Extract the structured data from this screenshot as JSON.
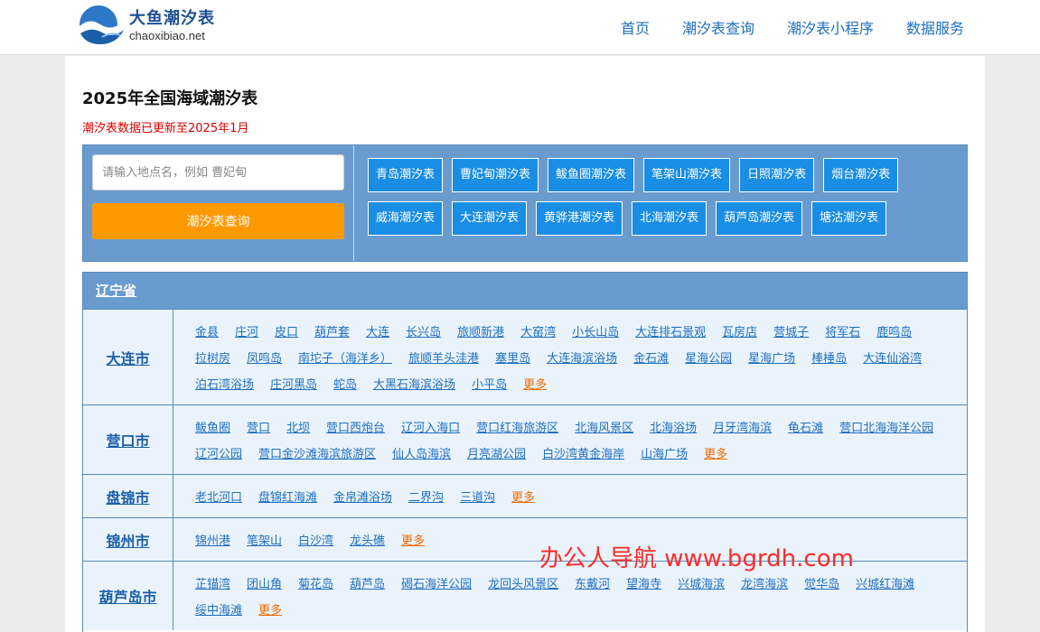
{
  "header": {
    "logo_cn": "大鱼潮汐表",
    "logo_en": "chaoxibiao.net",
    "nav": [
      "首页",
      "潮汐表查询",
      "潮汐表小程序",
      "数据服务"
    ]
  },
  "page": {
    "title": "2025年全国海域潮汐表",
    "update_note": "潮汐表数据已更新至2025年1月"
  },
  "search": {
    "placeholder": "请输入地点名，例如 曹妃甸",
    "button_label": "潮汐表查询",
    "quick_links": [
      "青岛潮汐表",
      "曹妃甸潮汐表",
      "鲅鱼圈潮汐表",
      "笔架山潮汐表",
      "日照潮汐表",
      "烟台潮汐表",
      "威海潮汐表",
      "大连潮汐表",
      "黄骅港潮汐表",
      "北海潮汐表",
      "葫芦岛潮汐表",
      "塘沽潮汐表"
    ]
  },
  "province": {
    "name": "辽宁省",
    "more_label": "更多",
    "cities": [
      {
        "name": "大连市",
        "places": [
          "金县",
          "庄河",
          "皮口",
          "葫芦套",
          "大连",
          "长兴岛",
          "旅顺新港",
          "大窑湾",
          "小长山岛",
          "大连排石景观",
          "瓦房店",
          "营城子",
          "将军石",
          "鹿鸣岛",
          "拉树房",
          "凤鸣岛",
          "南坨子（海洋乡）",
          "旅顺羊头洼港",
          "塞里岛",
          "大连海滨浴场",
          "金石滩",
          "星海公园",
          "星海广场",
          "棒棰岛",
          "大连仙浴湾",
          "泊石湾浴场",
          "庄河黑岛",
          "蛇岛",
          "大黑石海滨浴场",
          "小平岛"
        ]
      },
      {
        "name": "营口市",
        "places": [
          "鲅鱼圈",
          "营口",
          "北坝",
          "营口西炮台",
          "辽河入海口",
          "营口红海旅游区",
          "北海风景区",
          "北海浴场",
          "月牙湾海滨",
          "龟石滩",
          "营口北海海洋公园",
          "辽河公园",
          "营口金沙滩海滨旅游区",
          "仙人岛海滨",
          "月亮湖公园",
          "白沙湾黄金海岸",
          "山海广场"
        ]
      },
      {
        "name": "盘锦市",
        "places": [
          "老北河口",
          "盘锦红海滩",
          "金帛滩浴场",
          "二界沟",
          "三道沟"
        ]
      },
      {
        "name": "锦州市",
        "places": [
          "锦州港",
          "笔架山",
          "白沙湾",
          "龙头礁"
        ]
      },
      {
        "name": "葫芦岛市",
        "places": [
          "芷锚湾",
          "团山角",
          "菊花岛",
          "葫芦岛",
          "碣石海洋公园",
          "龙回头风景区",
          "东戴河",
          "望海寺",
          "兴城海滨",
          "龙湾海滨",
          "觉华岛",
          "兴城红海滩",
          "绥中海滩"
        ]
      }
    ]
  },
  "watermark": "办公人导航  www.bgrdh.com",
  "colors": {
    "brand_blue": "#1f6fbf",
    "panel_blue": "#6a9bcf",
    "button_orange": "#ff9900",
    "tag_blue": "#1a8de4",
    "row_bg": "#eaf3fc",
    "alert_red": "#e00000",
    "more_orange": "#f06a00"
  }
}
